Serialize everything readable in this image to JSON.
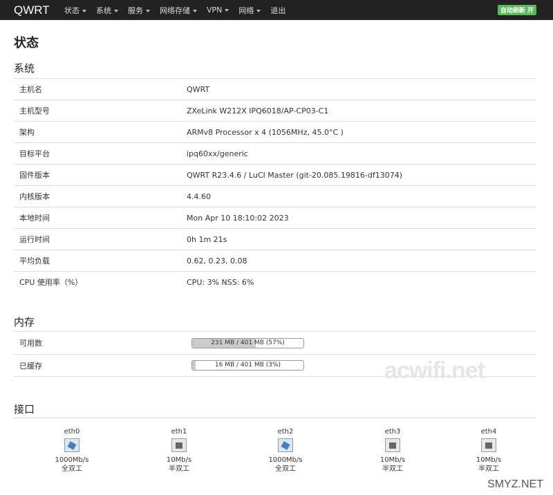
{
  "nav": {
    "brand": "QWRT",
    "menu": [
      "状态",
      "系统",
      "服务",
      "网络存储",
      "VPN",
      "网络",
      "退出"
    ],
    "autorefresh": "自动刷新 开"
  },
  "page_title": "状态",
  "system": {
    "title": "系统",
    "rows": [
      {
        "k": "主机名",
        "v": "QWRT"
      },
      {
        "k": "主机型号",
        "v": "ZXeLink W212X IPQ6018/AP-CP03-C1"
      },
      {
        "k": "架构",
        "v": "ARMv8 Processor x 4 (1056MHz, 45.0°C )"
      },
      {
        "k": "目标平台",
        "v": "ipq60xx/generic"
      },
      {
        "k": "固件版本",
        "v": "QWRT R23.4.6 / LuCI Master (git-20.085.19816-df13074)"
      },
      {
        "k": "内核版本",
        "v": "4.4.60"
      },
      {
        "k": "本地时间",
        "v": "Mon Apr 10 18:10:02 2023"
      },
      {
        "k": "运行时间",
        "v": "0h 1m 21s"
      },
      {
        "k": "平均负载",
        "v": "0.62, 0.23, 0.08"
      },
      {
        "k": "CPU 使用率（%）",
        "v": "CPU: 3% NSS: 6%"
      }
    ]
  },
  "memory": {
    "title": "内存",
    "rows": [
      {
        "k": "可用数",
        "text": "231 MB / 401 MB (57%)",
        "percent": 57
      },
      {
        "k": "已缓存",
        "text": "16 MB / 401 MB (3%)",
        "percent": 3
      }
    ]
  },
  "interfaces": {
    "title": "接口",
    "ports": [
      {
        "name": "eth0",
        "speed": "1000Mb/s",
        "duplex": "全双工",
        "link": "up"
      },
      {
        "name": "eth1",
        "speed": "10Mb/s",
        "duplex": "半双工",
        "link": "down"
      },
      {
        "name": "eth2",
        "speed": "1000Mb/s",
        "duplex": "全双工",
        "link": "up"
      },
      {
        "name": "eth3",
        "speed": "10Mb/s",
        "duplex": "半双工",
        "link": "down"
      },
      {
        "name": "eth4",
        "speed": "10Mb/s",
        "duplex": "半双工",
        "link": "down"
      }
    ]
  },
  "watermarks": [
    "acwifi.net",
    "SMYZ.NET"
  ]
}
